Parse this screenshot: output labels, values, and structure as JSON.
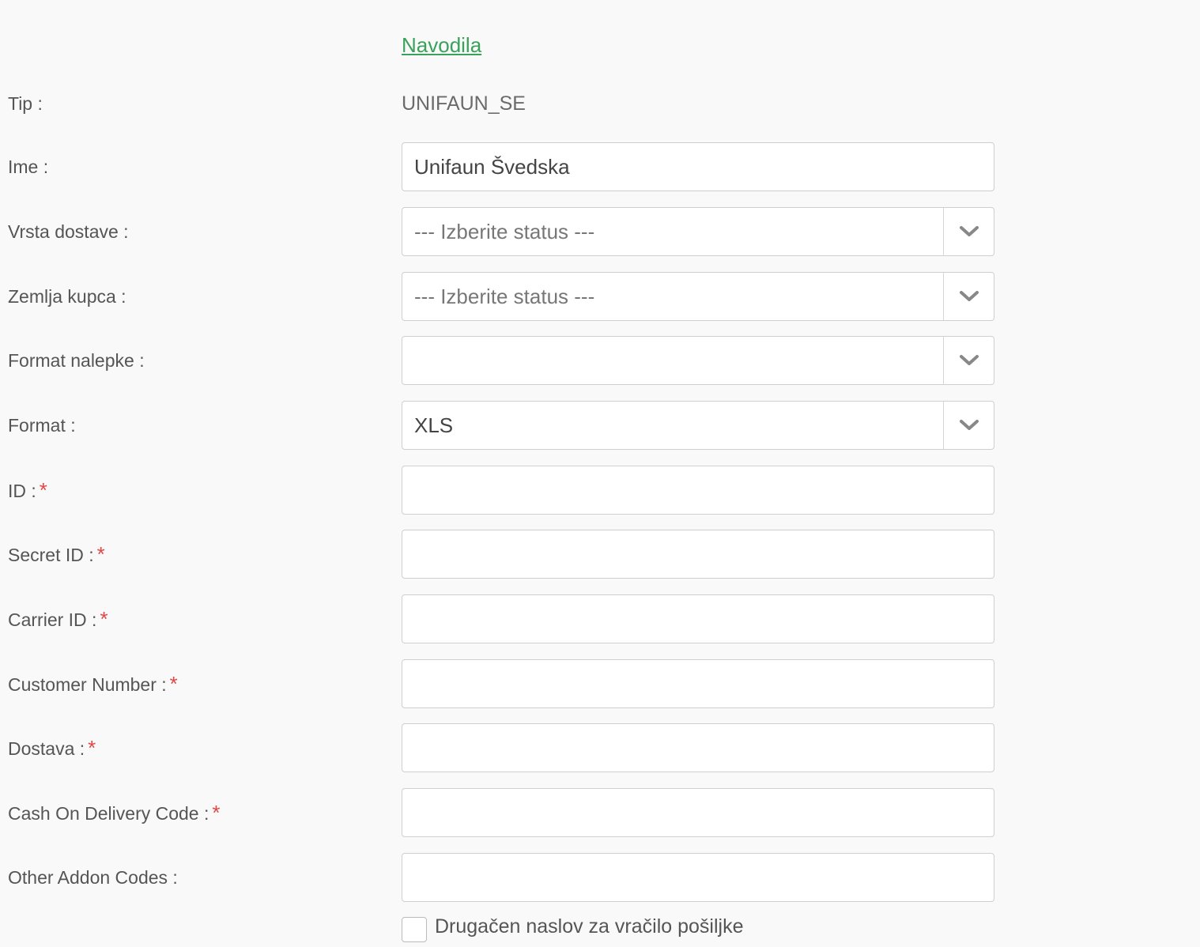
{
  "help_link": "Navodila",
  "fields": {
    "tip": {
      "label": "Tip :",
      "value": "UNIFAUN_SE"
    },
    "ime": {
      "label": "Ime :",
      "value": "Unifaun Švedska"
    },
    "vrsta_dostave": {
      "label": "Vrsta dostave :",
      "placeholder": "--- Izberite status ---"
    },
    "zemlja_kupca": {
      "label": "Zemlja kupca :",
      "placeholder": "--- Izberite status ---"
    },
    "format_nalepke": {
      "label": "Format nalepke :",
      "value": ""
    },
    "format": {
      "label": "Format :",
      "value": "XLS"
    },
    "id": {
      "label": "ID :",
      "required_mark": "*",
      "value": ""
    },
    "secret_id": {
      "label": "Secret ID :",
      "required_mark": "*",
      "value": ""
    },
    "carrier_id": {
      "label": "Carrier ID :",
      "required_mark": "*",
      "value": ""
    },
    "customer_number": {
      "label": "Customer Number :",
      "required_mark": "*",
      "value": ""
    },
    "dostava": {
      "label": "Dostava :",
      "required_mark": "*",
      "value": ""
    },
    "cod_code": {
      "label": "Cash On Delivery Code :",
      "required_mark": "*",
      "value": ""
    },
    "other_addon_codes": {
      "label": "Other Addon Codes :",
      "value": ""
    }
  },
  "return_address_checkbox": {
    "label": "Drugačen naslov za vračilo pošiljke",
    "checked": false
  },
  "icons": {
    "select_arrow": "chevron-down-icon"
  },
  "colors": {
    "link": "#3aa15b",
    "required": "#e04848",
    "background": "#f9f9f9"
  }
}
